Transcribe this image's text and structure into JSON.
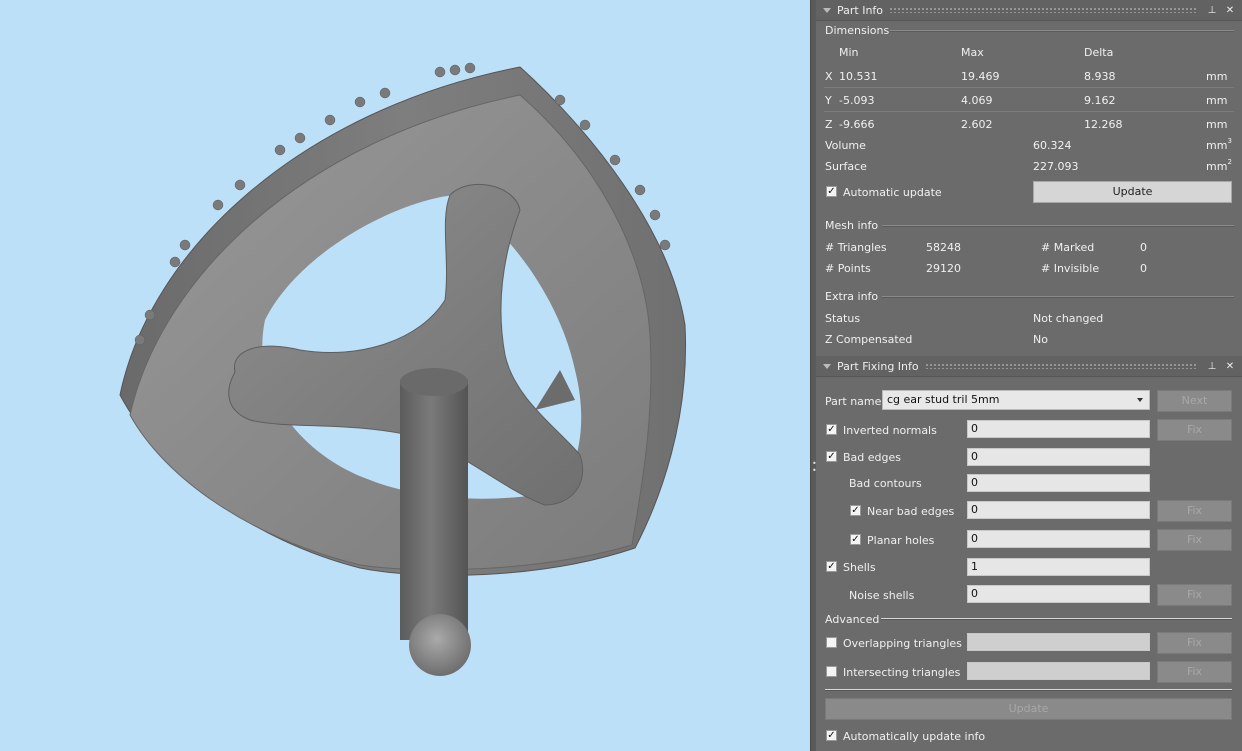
{
  "part_info": {
    "title": "Part Info",
    "dimensions": {
      "group_label": "Dimensions",
      "headers": {
        "min": "Min",
        "max": "Max",
        "delta": "Delta"
      },
      "rows": [
        {
          "axis": "X",
          "min": "10.531",
          "max": "19.469",
          "delta": "8.938",
          "unit": "mm"
        },
        {
          "axis": "Y",
          "min": "-5.093",
          "max": "4.069",
          "delta": "9.162",
          "unit": "mm"
        },
        {
          "axis": "Z",
          "min": "-9.666",
          "max": "2.602",
          "delta": "12.268",
          "unit": "mm"
        }
      ],
      "volume_label": "Volume",
      "volume_value": "60.324",
      "volume_unit": "mm",
      "volume_exp": "3",
      "surface_label": "Surface",
      "surface_value": "227.093",
      "surface_unit": "mm",
      "surface_exp": "2",
      "auto_update_label": "Automatic update",
      "auto_update_checked": true,
      "update_button": "Update"
    },
    "mesh_info": {
      "group_label": "Mesh info",
      "triangles_label": "# Triangles",
      "triangles_value": "58248",
      "points_label": "# Points",
      "points_value": "29120",
      "marked_label": "# Marked",
      "marked_value": "0",
      "invisible_label": "# Invisible",
      "invisible_value": "0"
    },
    "extra_info": {
      "group_label": "Extra info",
      "status_label": "Status",
      "status_value": "Not changed",
      "zcomp_label": "Z Compensated",
      "zcomp_value": "No"
    }
  },
  "part_fixing": {
    "title": "Part Fixing Info",
    "part_name_label": "Part name",
    "part_name_value": "cg ear stud tril 5mm",
    "next_button": "Next",
    "fix_label": "Fix",
    "inverted_normals_label": "Inverted normals",
    "inverted_normals_value": "0",
    "bad_edges_label": "Bad edges",
    "bad_edges_value": "0",
    "bad_contours_label": "Bad contours",
    "bad_contours_value": "0",
    "near_bad_edges_label": "Near bad edges",
    "near_bad_edges_value": "0",
    "planar_holes_label": "Planar holes",
    "planar_holes_value": "0",
    "shells_label": "Shells",
    "shells_value": "1",
    "noise_shells_label": "Noise shells",
    "noise_shells_value": "0",
    "advanced_label": "Advanced",
    "overlapping_label": "Overlapping triangles",
    "intersecting_label": "Intersecting triangles",
    "update_button": "Update",
    "auto_update_info_label": "Automatically update info"
  },
  "colors": {
    "viewport_bg": "#bde0f9",
    "panel_bg": "#6b6b6b",
    "model_gray": "#8c8c8c"
  },
  "icons": [
    "collapse-triangle-icon",
    "pin-icon",
    "close-icon",
    "checkmark-icon",
    "dropdown-arrow-icon"
  ]
}
